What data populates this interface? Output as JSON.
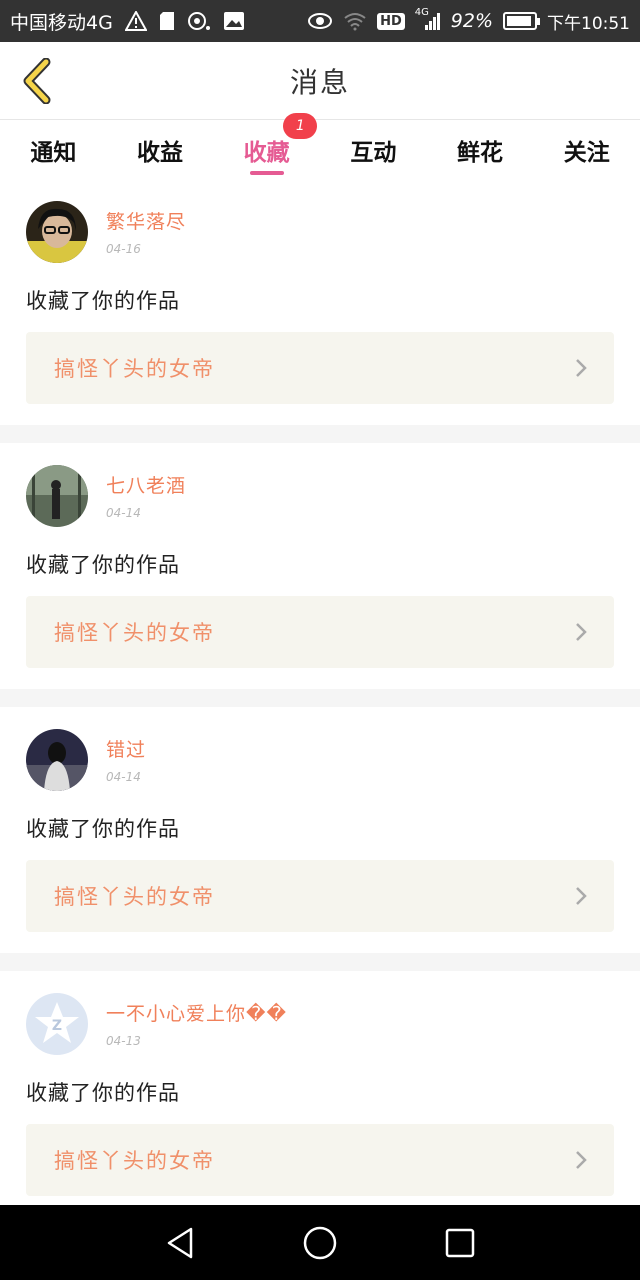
{
  "status": {
    "carrier": "中国移动4G",
    "battery": "92%",
    "battery_level": 0.92,
    "time": "下午10:51",
    "network": "4G",
    "hd": "HD"
  },
  "header": {
    "title": "消息"
  },
  "tabs": [
    {
      "label": "通知"
    },
    {
      "label": "收益"
    },
    {
      "label": "收藏",
      "active": true,
      "badge": "1"
    },
    {
      "label": "互动"
    },
    {
      "label": "鲜花"
    },
    {
      "label": "关注"
    }
  ],
  "messages": [
    {
      "user": "繁华落尽",
      "date": "04-16",
      "action": "收藏了你的作品",
      "work": "搞怪丫头的女帝",
      "avatar": "photo-glasses"
    },
    {
      "user": "七八老酒",
      "date": "04-14",
      "action": "收藏了你的作品",
      "work": "搞怪丫头的女帝",
      "avatar": "photo-street"
    },
    {
      "user": "错过",
      "date": "04-14",
      "action": "收藏了你的作品",
      "work": "搞怪丫头的女帝",
      "avatar": "photo-girl"
    },
    {
      "user": "一不小心爱上你��",
      "date": "04-13",
      "action": "收藏了你的作品",
      "work": "搞怪丫头的女帝",
      "avatar": "default-star"
    }
  ],
  "colors": {
    "accent": "#e55b93",
    "username": "#f0805a",
    "work_title": "#f0906a",
    "badge": "#f1404b"
  },
  "icons": {
    "back": "chevron-left-icon",
    "work_arrow": "chevron-right-icon",
    "nav": [
      "nav-back-icon",
      "nav-home-icon",
      "nav-recents-icon"
    ]
  }
}
